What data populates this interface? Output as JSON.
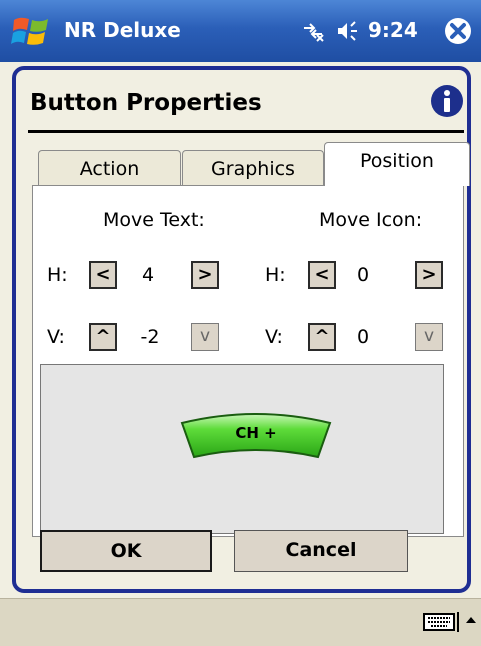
{
  "titlebar": {
    "app_title": "NR Deluxe",
    "clock": "9:24"
  },
  "dialog": {
    "title": "Button Properties",
    "tabs": [
      {
        "label": "Action"
      },
      {
        "label": "Graphics"
      },
      {
        "label": "Position"
      }
    ],
    "move_text": {
      "heading": "Move Text:",
      "h_label": "H:",
      "h_value": "4",
      "v_label": "V:",
      "v_value": "-2"
    },
    "move_icon": {
      "heading": "Move Icon:",
      "h_label": "H:",
      "h_value": "0",
      "v_label": "V:",
      "v_value": "0"
    },
    "step_buttons": {
      "left": "<",
      "right": ">",
      "up": "^",
      "down": "v"
    },
    "preview": {
      "button_label": "CH +"
    },
    "ok_label": "OK",
    "cancel_label": "Cancel"
  },
  "colors": {
    "titlebar": "#2b5fb8",
    "dialog_border": "#1f2e93",
    "background": "#f1efe2",
    "preview_button": "#4dd12a"
  },
  "icons": [
    "windows-start-icon",
    "connectivity-icon",
    "speaker-icon",
    "close-icon",
    "info-icon",
    "keyboard-icon",
    "sip-arrow-icon"
  ]
}
